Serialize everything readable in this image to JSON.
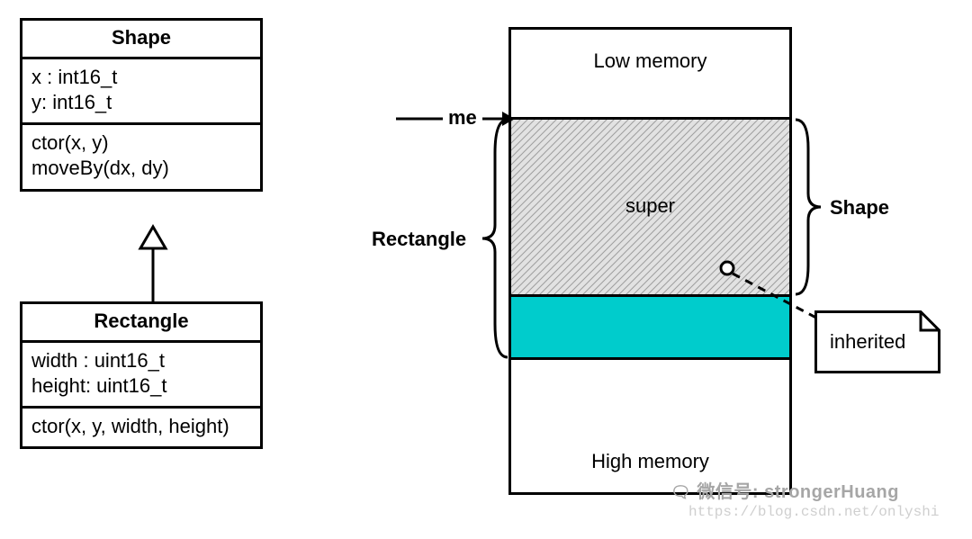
{
  "uml": {
    "shape": {
      "title": "Shape",
      "attrs": [
        "x : int16_t",
        "y: int16_t"
      ],
      "ops": [
        "ctor(x, y)",
        "moveBy(dx, dy)"
      ]
    },
    "rectangle": {
      "title": "Rectangle",
      "attrs": [
        "width : uint16_t",
        "height: uint16_t"
      ],
      "ops": [
        "ctor(x, y, width, height)"
      ]
    }
  },
  "memory": {
    "low": "Low memory",
    "high": "High memory",
    "me": "me",
    "rectangle": "Rectangle",
    "shape": "Shape",
    "super": "super",
    "inherited": "inherited"
  },
  "watermark": {
    "line1": "微信号: strongerHuang",
    "line2": "https://blog.csdn.net/onlyshi"
  }
}
